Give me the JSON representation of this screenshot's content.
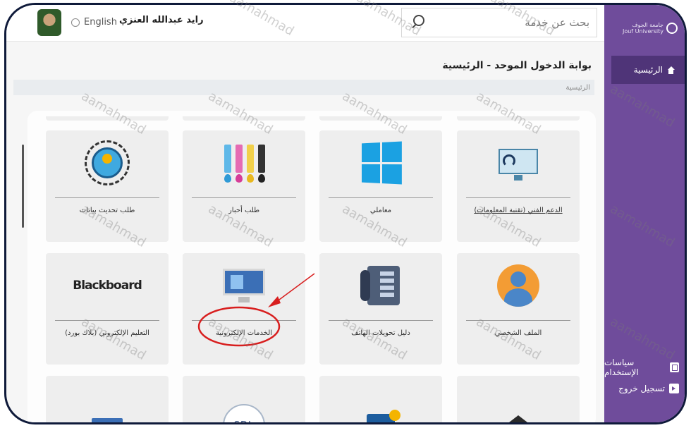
{
  "topbar": {
    "username": "رايد عبدالله العنزي",
    "language_label": "English",
    "search_placeholder": "بحث عن خدمة"
  },
  "sidebar": {
    "brand_line1": "جامعة الجوف",
    "brand_line2": "Jouf University",
    "home_label": "الرئيسية",
    "policy_label": "سياسات الإستخدام",
    "logout_label": "تسجيل خروج"
  },
  "page": {
    "title": "بوابة الدخول الموحد - الرئيسية",
    "breadcrumb": "الرئيسية"
  },
  "services": [
    {
      "label": "طلب تحديث بيانات",
      "icon": "refresh-user-icon"
    },
    {
      "label": "طلب أحبار",
      "icon": "ink-cartridges-icon"
    },
    {
      "label": "معاملي",
      "icon": "windows-icon"
    },
    {
      "label": "الدعم الفني (تقنية المعلومات)",
      "icon": "tech-support-icon"
    },
    {
      "label": "التعليم الإلكتروني (بلاك بورد)",
      "icon": "blackboard-logo",
      "logo_text": "Blackboard"
    },
    {
      "label": "الخدمات الإلكترونية",
      "icon": "computer-monitor-icon"
    },
    {
      "label": "دليل تحويلات الهاتف",
      "icon": "telephone-icon"
    },
    {
      "label": "الملف الشخصي",
      "icon": "profile-person-icon"
    },
    {
      "icon": "web-page-icon"
    },
    {
      "icon": "sdl-logo",
      "logo_text": "SDL"
    },
    {
      "icon": "book-icon"
    },
    {
      "icon": "graduation-cap-icon"
    }
  ],
  "annotation": {
    "watermark_text": "aamahmad",
    "highlight_color": "#d81e1e",
    "highlighted_service": "الخدمات الإلكترونية"
  },
  "colors": {
    "sidebar": "#6f4c9b",
    "sidebar_active": "#4f3478",
    "frame_border": "#0f1a3a"
  }
}
